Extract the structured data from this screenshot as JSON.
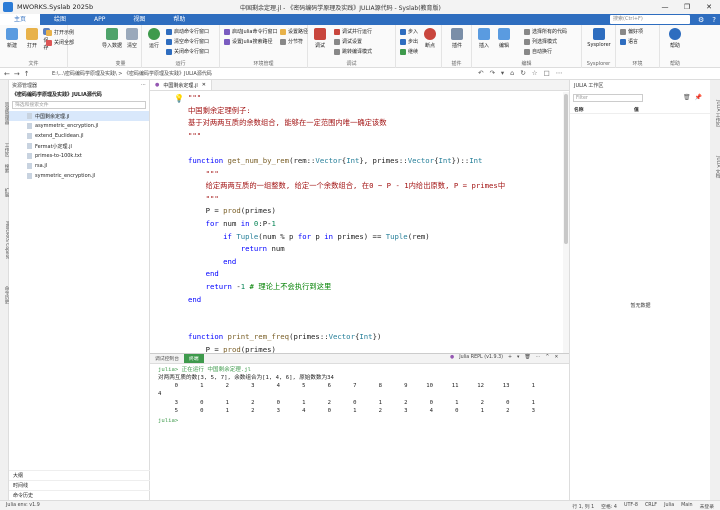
{
  "window": {
    "app_name": "MWORKS.Syslab 2025b",
    "doc_title": "中国剩余定理.jl - 《密码编码学原理及实践》JULIA源代码 - Syslab(教育版)",
    "controls": [
      "—",
      "❐",
      "✕"
    ]
  },
  "menu": {
    "items": [
      "主页",
      "绘图",
      "APP",
      "视图",
      "帮助"
    ],
    "active_index": 0,
    "search_placeholder": "搜索(Ctrl+F)"
  },
  "ribbon": {
    "groups": [
      {
        "label": "文件",
        "big": [
          "新建",
          "打开",
          "保存"
        ],
        "small": [
          "打开示例",
          "关闭全部"
        ]
      },
      {
        "label": "变量",
        "big": [
          "导入数据",
          "清空"
        ],
        "small": []
      },
      {
        "label": "运行",
        "big": [
          "运行"
        ],
        "small": [
          "启动命令行窗口",
          "清空命令行窗口",
          "关闭命令行窗口"
        ]
      },
      {
        "label": "环境管理",
        "big": [],
        "small": [
          "启动Julia命令行窗口",
          "设置Julia搜索路径",
          "设置路径",
          "分节符"
        ]
      },
      {
        "label": "调试",
        "big": [
          "调试"
        ],
        "small": [
          "调试并行运行",
          "调试设置",
          "跳转编译模式"
        ]
      },
      {
        "label": "",
        "big": [
          "断点"
        ],
        "small": [
          "步入",
          "步出",
          "继续"
        ]
      },
      {
        "label": "插件",
        "big": [
          "插件"
        ],
        "small": []
      },
      {
        "label": "编辑",
        "big": [
          "插入",
          "编辑"
        ],
        "small": [
          "选择所有的代码",
          "列选择模式",
          "自动换行"
        ]
      },
      {
        "label": "Sysplorer",
        "big": [
          "Sysplorer"
        ],
        "small": []
      },
      {
        "label": "环境",
        "big": [],
        "small": [
          "偏好项",
          "语言"
        ]
      },
      {
        "label": "帮助",
        "big": [
          "帮助"
        ],
        "small": []
      }
    ]
  },
  "pathbar": {
    "path": "E:\\...\\密码编码学原理及实践\\ > 《密码编码学原理及实践》JULIA源代码",
    "tools": [
      "↶",
      "↷",
      "▾",
      "⌂",
      "↻",
      "☆",
      "□",
      "⋯"
    ]
  },
  "left_tabs": [
    "资源管理器",
    "工作区",
    "搜索",
    "扩展",
    "MWORKS Copilot",
    "命令历史"
  ],
  "explorer": {
    "header": "资源管理器",
    "project": "《密码编码学原理及实践》JULIA源代码",
    "search_placeholder": "筛选和搜索文件",
    "files": [
      "中国剩余定理.jl",
      "asymmetric_encryption.jl",
      "extend_Euclidean.jl",
      "Fermat小定理.jl",
      "primes-to-100k.txt",
      "rsa.jl",
      "symmetric_encryption.jl"
    ],
    "selected_index": 0,
    "bottom_sections": [
      "大纲",
      "时间线",
      "命令历史"
    ]
  },
  "editor": {
    "tab": "中国剩余定理.jl",
    "code_lines": [
      [
        {
          "t": "\"\"\"",
          "c": "str"
        }
      ],
      [
        {
          "t": "中国剩余定理例子:",
          "c": "str"
        }
      ],
      [
        {
          "t": "基于对两两互质的余数组合, 能够在一定范围内唯一确定该数",
          "c": "str"
        }
      ],
      [
        {
          "t": "\"\"\"",
          "c": "str"
        }
      ],
      [],
      [
        {
          "t": "function ",
          "c": "kw"
        },
        {
          "t": "get_num_by_rem",
          "c": "fn"
        },
        {
          "t": "(rem::",
          "c": ""
        },
        {
          "t": "Vector",
          "c": "ty"
        },
        {
          "t": "{",
          "c": ""
        },
        {
          "t": "Int",
          "c": "ty"
        },
        {
          "t": "}, primes::",
          "c": ""
        },
        {
          "t": "Vector",
          "c": "ty"
        },
        {
          "t": "{",
          "c": ""
        },
        {
          "t": "Int",
          "c": "ty"
        },
        {
          "t": "})::",
          "c": ""
        },
        {
          "t": "Int",
          "c": "ty"
        }
      ],
      [
        {
          "t": "    \"\"\"",
          "c": "str"
        }
      ],
      [
        {
          "t": "    给定两两互质的一组整数, 给定一个余数组合, 在0 ~ P - 1内给出原数, P = primes中",
          "c": "str"
        }
      ],
      [
        {
          "t": "    \"\"\"",
          "c": "str"
        }
      ],
      [
        {
          "t": "    P = ",
          "c": ""
        },
        {
          "t": "prod",
          "c": "fn"
        },
        {
          "t": "(primes)",
          "c": ""
        }
      ],
      [
        {
          "t": "    for ",
          "c": "kw"
        },
        {
          "t": "num ",
          "c": ""
        },
        {
          "t": "in ",
          "c": "kw"
        },
        {
          "t": "0",
          "c": "num"
        },
        {
          "t": ":P-",
          "c": ""
        },
        {
          "t": "1",
          "c": "num"
        }
      ],
      [
        {
          "t": "        if ",
          "c": "kw"
        },
        {
          "t": "Tuple",
          "c": "ty"
        },
        {
          "t": "(num % p ",
          "c": ""
        },
        {
          "t": "for ",
          "c": "kw"
        },
        {
          "t": "p ",
          "c": ""
        },
        {
          "t": "in ",
          "c": "kw"
        },
        {
          "t": "primes) == ",
          "c": ""
        },
        {
          "t": "Tuple",
          "c": "ty"
        },
        {
          "t": "(rem)",
          "c": ""
        }
      ],
      [
        {
          "t": "            return ",
          "c": "kw"
        },
        {
          "t": "num",
          "c": ""
        }
      ],
      [
        {
          "t": "        end",
          "c": "kw"
        }
      ],
      [
        {
          "t": "    end",
          "c": "kw"
        }
      ],
      [
        {
          "t": "    return ",
          "c": "kw"
        },
        {
          "t": "-",
          "c": ""
        },
        {
          "t": "1",
          "c": "num"
        },
        {
          "t": " # 理论上不会执行到这里",
          "c": "cm"
        }
      ],
      [
        {
          "t": "end",
          "c": "kw"
        }
      ],
      [],
      [],
      [
        {
          "t": "function ",
          "c": "kw"
        },
        {
          "t": "print_rem_freq",
          "c": "fn"
        },
        {
          "t": "(primes::",
          "c": ""
        },
        {
          "t": "Vector",
          "c": "ty"
        },
        {
          "t": "{",
          "c": ""
        },
        {
          "t": "Int",
          "c": "ty"
        },
        {
          "t": "})",
          "c": ""
        }
      ],
      [
        {
          "t": "    P = ",
          "c": ""
        },
        {
          "t": "prod",
          "c": "fn"
        },
        {
          "t": "(primes)",
          "c": ""
        }
      ]
    ]
  },
  "terminal": {
    "tabs": [
      "调试控制台",
      "终端"
    ],
    "active_index": 1,
    "repl_label": "Julia REPL (v1.9.3)",
    "repl_tools": [
      "+",
      "▾",
      "🗑",
      "⋯",
      "^",
      "✕"
    ],
    "line1_prompt": "julia>",
    "line1_text": " 正在运行 中国剩余定理.jl",
    "line2": "对两两互质的数[3, 5, 7], 余数组合为[1, 4, 6], 原始数数为34",
    "grid": [
      [
        "0",
        "1",
        "2",
        "3",
        "4",
        "5",
        "6",
        "7",
        "8",
        "9",
        "10",
        "11",
        "12",
        "13",
        "1"
      ],
      [
        "4"
      ],
      [
        "3",
        "0",
        "1",
        "2",
        "0",
        "1",
        "2",
        "0",
        "1",
        "2",
        "0",
        "1",
        "2",
        "0",
        "1"
      ],
      [
        "5",
        "0",
        "1",
        "2",
        "3",
        "4",
        "0",
        "1",
        "2",
        "3",
        "4",
        "0",
        "1",
        "2",
        "3"
      ]
    ],
    "last_prompt": "julia>"
  },
  "right_panel": {
    "title": "JULIA 工作区",
    "filter_placeholder": "Filter",
    "col_name": "名称",
    "col_value": "值",
    "empty_text": "暂无数据"
  },
  "right_tabs": [
    "JULIA 工作区",
    "JULIA 文档"
  ],
  "statusbar": {
    "left": "Julia env: v1.9",
    "right": [
      "行 1, 列 1",
      "空格: 4",
      "UTF-8",
      "CRLF",
      "Julia",
      "Main",
      "未登录"
    ]
  }
}
